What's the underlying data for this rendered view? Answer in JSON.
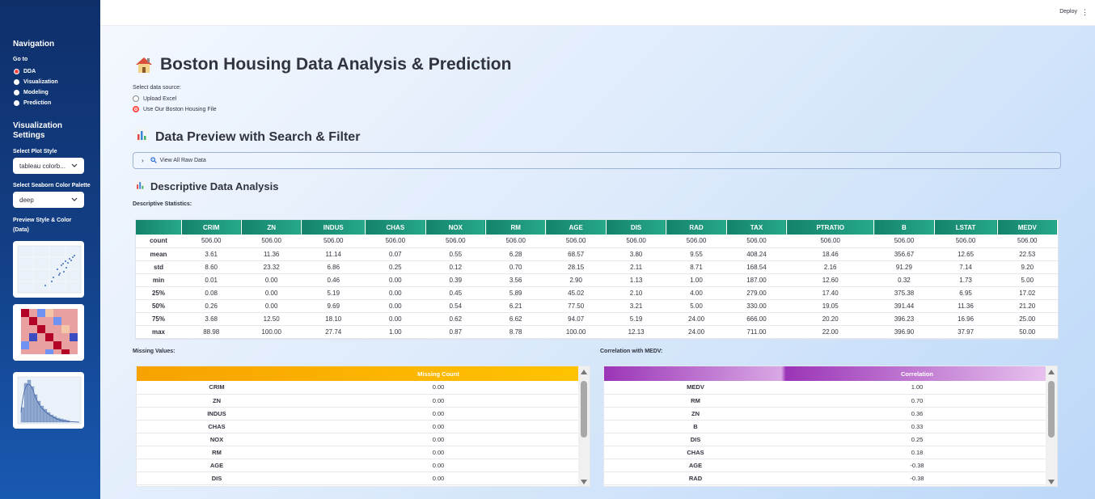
{
  "topbar": {
    "deploy": "Deploy",
    "menu_glyph": "⋮"
  },
  "sidebar": {
    "nav_title": "Navigation",
    "goto_label": "Go to",
    "nav_items": [
      {
        "label": "DDA",
        "selected": true
      },
      {
        "label": "Visualization",
        "selected": false
      },
      {
        "label": "Modeling",
        "selected": false
      },
      {
        "label": "Prediction",
        "selected": false
      }
    ],
    "viz_title_1": "Visualization",
    "viz_title_2": "Settings",
    "plot_style_label": "Select Plot Style",
    "plot_style_value": "tableau colorb...",
    "palette_label": "Select Seaborn Color Palette",
    "palette_value": "deep",
    "preview_label_1": "Preview Style & Color",
    "preview_label_2": "(Data)"
  },
  "main": {
    "title": "Boston Housing Data Analysis & Prediction",
    "source_label": "Select data source:",
    "source_options": [
      {
        "label": "Upload Excel",
        "selected": false
      },
      {
        "label": "Use Our Boston Housing File",
        "selected": true
      }
    ],
    "preview_heading": "Data Preview with Search & Filter",
    "expander_label": "View All Raw Data",
    "dda_heading": "Descriptive Data Analysis",
    "desc_label": "Descriptive Statistics:",
    "missing_label": "Missing Values:",
    "corr_label": "Correlation with MEDV:"
  },
  "stats": {
    "columns": [
      "CRIM",
      "ZN",
      "INDUS",
      "CHAS",
      "NOX",
      "RM",
      "AGE",
      "DIS",
      "RAD",
      "TAX",
      "PTRATIO",
      "B",
      "LSTAT",
      "MEDV"
    ],
    "rows": [
      {
        "label": "count",
        "values": [
          "506.00",
          "506.00",
          "506.00",
          "506.00",
          "506.00",
          "506.00",
          "506.00",
          "506.00",
          "506.00",
          "506.00",
          "506.00",
          "506.00",
          "506.00",
          "506.00"
        ]
      },
      {
        "label": "mean",
        "values": [
          "3.61",
          "11.36",
          "11.14",
          "0.07",
          "0.55",
          "6.28",
          "68.57",
          "3.80",
          "9.55",
          "408.24",
          "18.46",
          "356.67",
          "12.65",
          "22.53"
        ]
      },
      {
        "label": "std",
        "values": [
          "8.60",
          "23.32",
          "6.86",
          "0.25",
          "0.12",
          "0.70",
          "28.15",
          "2.11",
          "8.71",
          "168.54",
          "2.16",
          "91.29",
          "7.14",
          "9.20"
        ]
      },
      {
        "label": "min",
        "values": [
          "0.01",
          "0.00",
          "0.46",
          "0.00",
          "0.39",
          "3.56",
          "2.90",
          "1.13",
          "1.00",
          "187.00",
          "12.60",
          "0.32",
          "1.73",
          "5.00"
        ]
      },
      {
        "label": "25%",
        "values": [
          "0.08",
          "0.00",
          "5.19",
          "0.00",
          "0.45",
          "5.89",
          "45.02",
          "2.10",
          "4.00",
          "279.00",
          "17.40",
          "375.38",
          "6.95",
          "17.02"
        ]
      },
      {
        "label": "50%",
        "values": [
          "0.26",
          "0.00",
          "9.69",
          "0.00",
          "0.54",
          "6.21",
          "77.50",
          "3.21",
          "5.00",
          "330.00",
          "19.05",
          "391.44",
          "11.36",
          "21.20"
        ]
      },
      {
        "label": "75%",
        "values": [
          "3.68",
          "12.50",
          "18.10",
          "0.00",
          "0.62",
          "6.62",
          "94.07",
          "5.19",
          "24.00",
          "666.00",
          "20.20",
          "396.23",
          "16.96",
          "25.00"
        ]
      },
      {
        "label": "max",
        "values": [
          "88.98",
          "100.00",
          "27.74",
          "1.00",
          "0.87",
          "8.78",
          "100.00",
          "12.13",
          "24.00",
          "711.00",
          "22.00",
          "396.90",
          "37.97",
          "50.00"
        ]
      }
    ]
  },
  "missing": {
    "header": "Missing Count",
    "rows": [
      {
        "label": "CRIM",
        "value": "0.00"
      },
      {
        "label": "ZN",
        "value": "0.00"
      },
      {
        "label": "INDUS",
        "value": "0.00"
      },
      {
        "label": "CHAS",
        "value": "0.00"
      },
      {
        "label": "NOX",
        "value": "0.00"
      },
      {
        "label": "RM",
        "value": "0.00"
      },
      {
        "label": "AGE",
        "value": "0.00"
      },
      {
        "label": "DIS",
        "value": "0.00"
      }
    ]
  },
  "correlation": {
    "header": "Correlation",
    "rows": [
      {
        "label": "MEDV",
        "value": "1.00"
      },
      {
        "label": "RM",
        "value": "0.70"
      },
      {
        "label": "ZN",
        "value": "0.36"
      },
      {
        "label": "B",
        "value": "0.33"
      },
      {
        "label": "DIS",
        "value": "0.25"
      },
      {
        "label": "CHAS",
        "value": "0.18"
      },
      {
        "label": "AGE",
        "value": "-0.38"
      },
      {
        "label": "RAD",
        "value": "-0.38"
      }
    ]
  },
  "colors": {
    "accent": "#ff4b4b",
    "stats_header": "#14826b",
    "missing_header": "#f7a200",
    "corr_header": "#9b35b7"
  }
}
